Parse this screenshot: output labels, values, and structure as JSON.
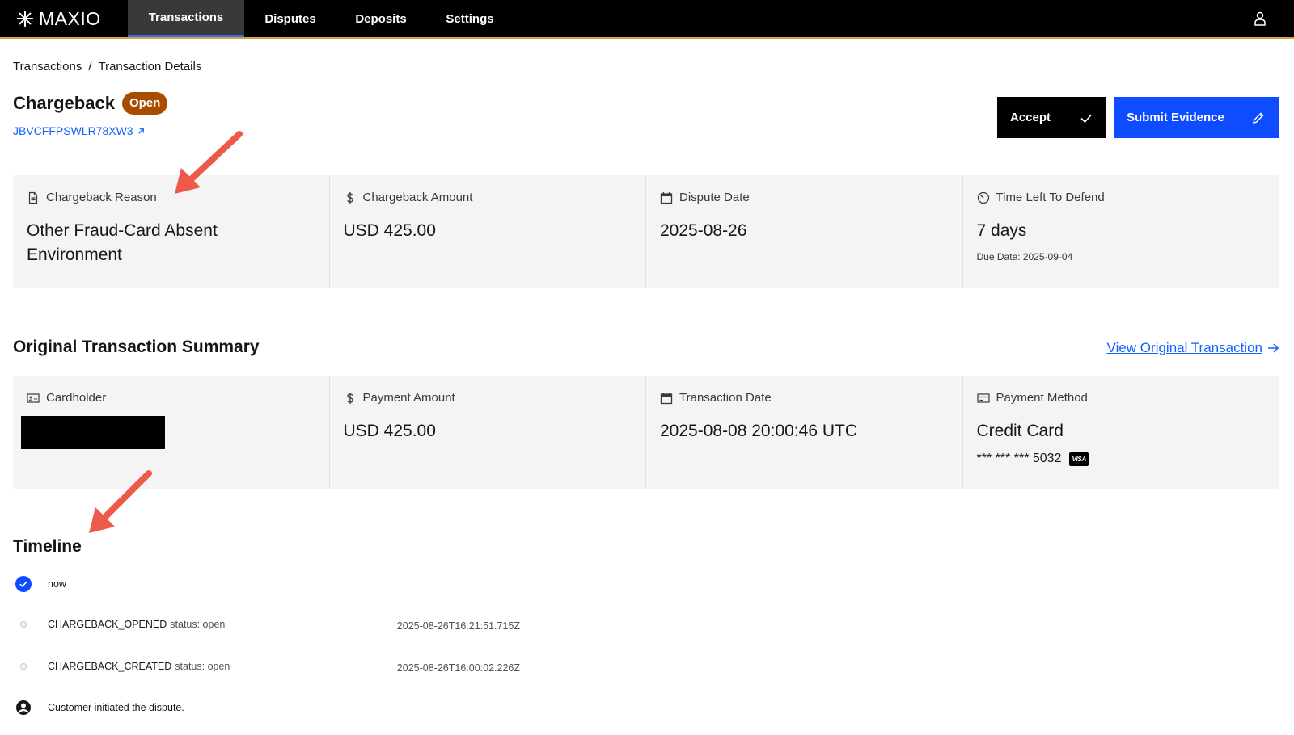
{
  "nav": {
    "brand": "MAXIO",
    "items": [
      {
        "label": "Transactions",
        "active": true
      },
      {
        "label": "Disputes",
        "active": false
      },
      {
        "label": "Deposits",
        "active": false
      },
      {
        "label": "Settings",
        "active": false
      }
    ],
    "user_icon": "user-icon"
  },
  "breadcrumb": {
    "parent": "Transactions",
    "separator": "/",
    "current": "Transaction Details"
  },
  "header": {
    "title": "Chargeback",
    "status_badge": "Open",
    "reference": "JBVCFFPSWLR78XW3"
  },
  "actions": {
    "accept_label": "Accept",
    "submit_label": "Submit Evidence"
  },
  "chargeback_cards": [
    {
      "icon": "document-icon",
      "label": "Chargeback Reason",
      "value": "Other Fraud-Card Absent Environment"
    },
    {
      "icon": "dollar-icon",
      "label": "Chargeback Amount",
      "value": "USD 425.00"
    },
    {
      "icon": "calendar-icon",
      "label": "Dispute Date",
      "value": "2025-08-26"
    },
    {
      "icon": "clock-icon",
      "label": "Time Left To Defend",
      "value": "7 days",
      "sub": "Due Date: 2025-09-04"
    }
  ],
  "summary": {
    "title": "Original Transaction Summary",
    "view_link": "View Original Transaction",
    "cards": [
      {
        "icon": "id-card-icon",
        "label": "Cardholder",
        "value": ""
      },
      {
        "icon": "dollar-icon",
        "label": "Payment Amount",
        "value": "USD 425.00"
      },
      {
        "icon": "calendar-icon",
        "label": "Transaction Date",
        "value": "2025-08-08 20:00:46 UTC"
      },
      {
        "icon": "credit-card-icon",
        "label": "Payment Method",
        "value": "Credit Card",
        "masked": "*** *** *** 5032",
        "brand": "VISA"
      }
    ]
  },
  "timeline": {
    "title": "Timeline",
    "events": [
      {
        "icon": "check-circle-icon",
        "event": "now",
        "status": "",
        "timestamp": ""
      },
      {
        "icon": "dot-icon",
        "event": "CHARGEBACK_OPENED",
        "status": "status: open",
        "timestamp": "2025-08-26T16:21:51.715Z"
      },
      {
        "icon": "dot-icon",
        "event": "CHARGEBACK_CREATED",
        "status": "status: open",
        "timestamp": "2025-08-26T16:00:02.226Z"
      },
      {
        "icon": "user-circle-icon",
        "event": "Customer initiated the dispute.",
        "status": "",
        "timestamp": ""
      }
    ]
  },
  "colors": {
    "nav_bg": "#000000",
    "nav_accent": "#d8a23a",
    "primary_blue": "#0f4cff",
    "badge_open": "#a84c00",
    "annotation_red": "#ee5a4a"
  }
}
